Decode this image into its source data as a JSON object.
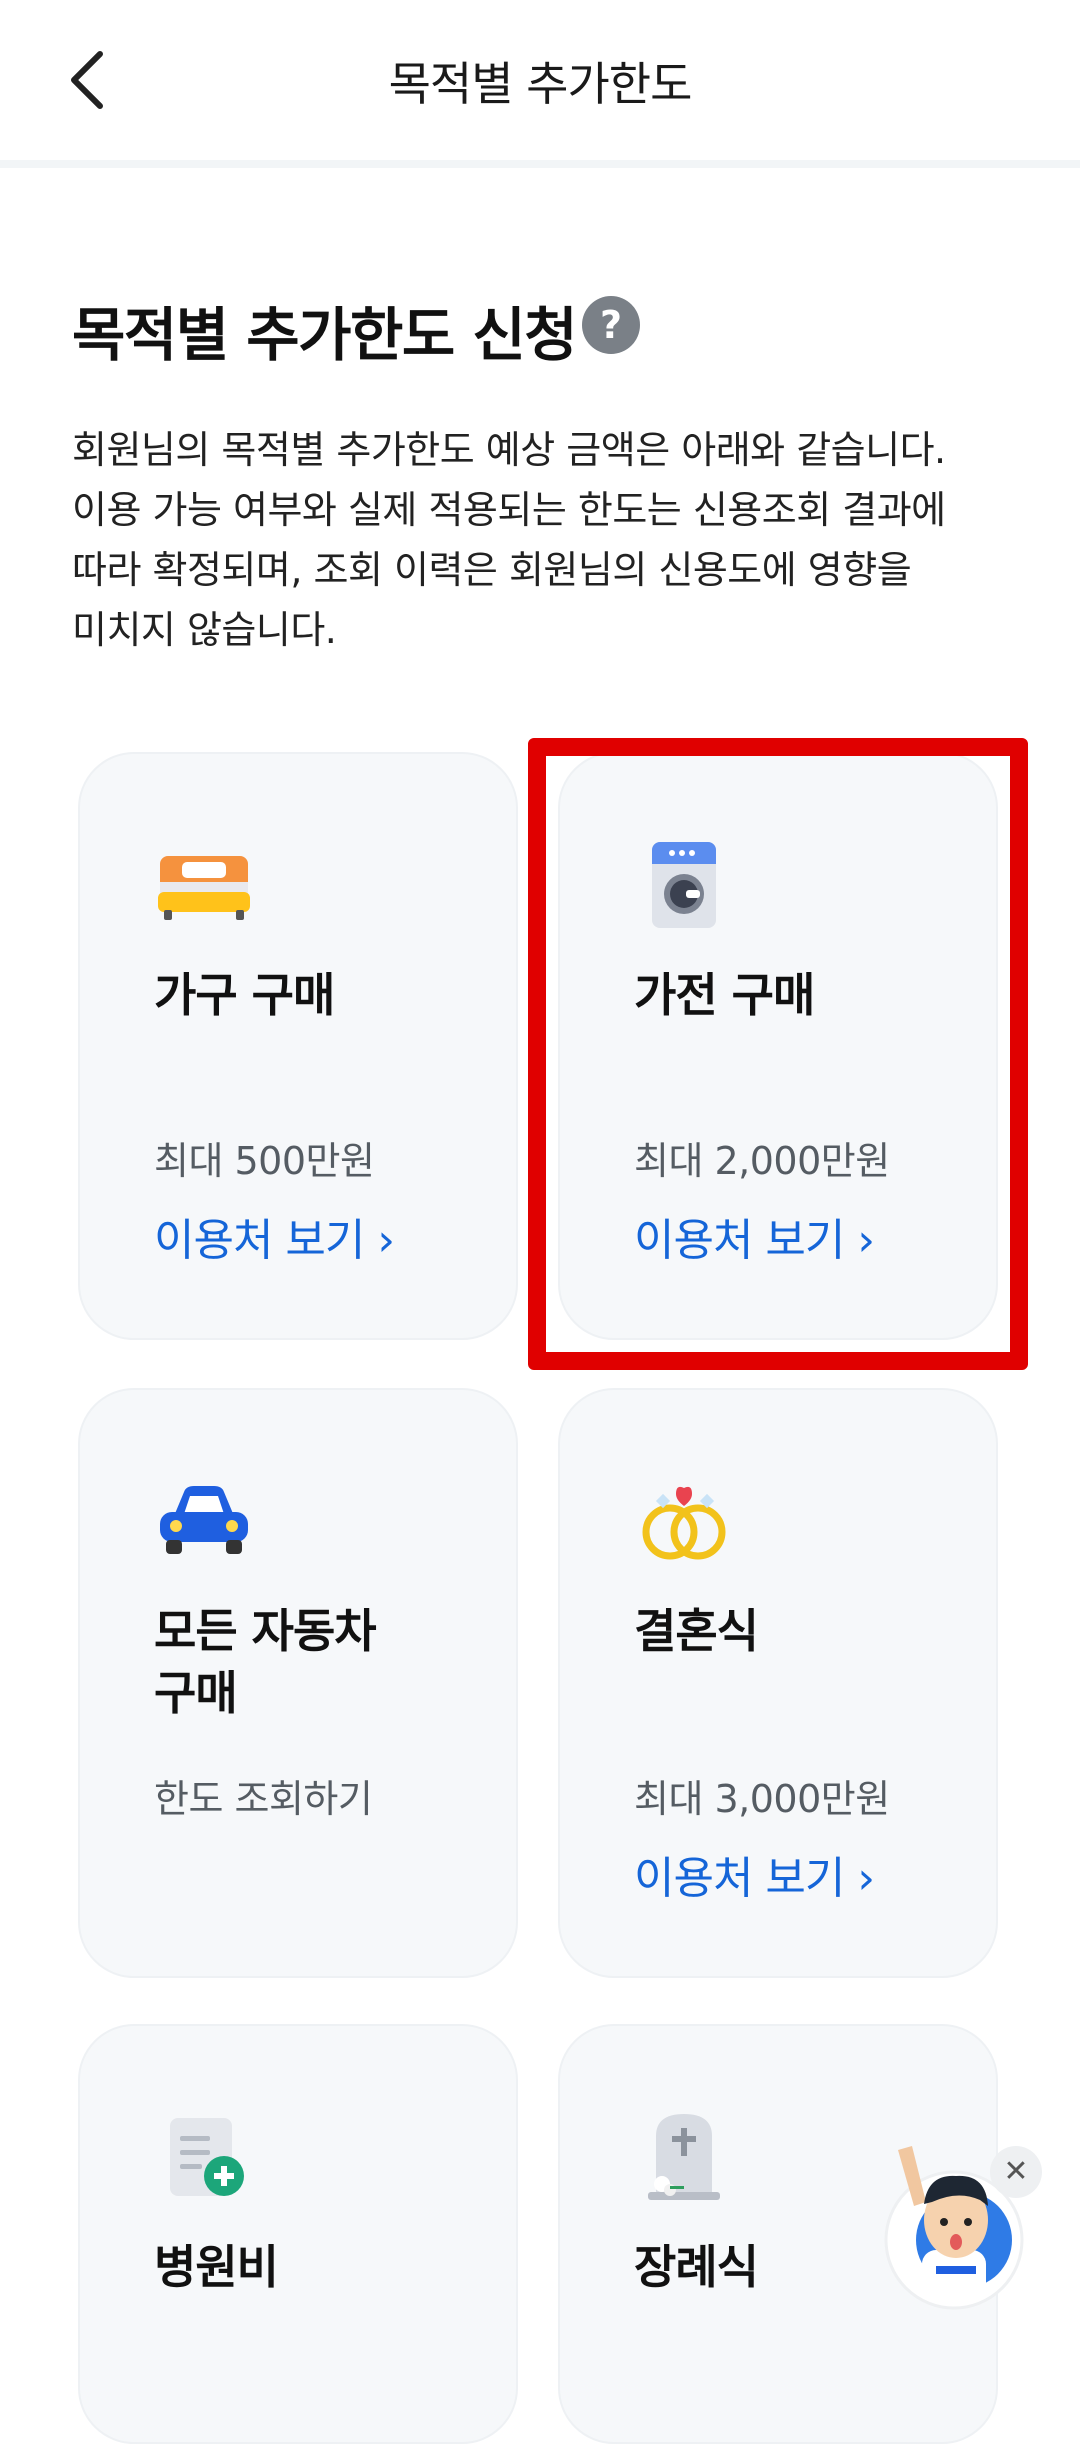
{
  "header": {
    "title": "목적별 추가한도"
  },
  "main": {
    "title": "목적별 추가한도 신청",
    "help": "?",
    "description": [
      "회원님의 목적별 추가한도 예상 금액은 아래와 같습니다.",
      "이용 가능 여부와 실제 적용되는 한도는 신용조회 결과에",
      "따라 확정되며, 조회 이력은 회원님의 신용도에 영향을",
      "미치지 않습니다."
    ]
  },
  "cards": [
    {
      "icon": "bed-icon",
      "title": "가구 구매",
      "limit": "최대 500만원",
      "link": "이용처 보기 ›"
    },
    {
      "icon": "washing-machine-icon",
      "title": "가전 구매",
      "limit": "최대 2,000만원",
      "link": "이용처 보기 ›"
    },
    {
      "icon": "car-icon",
      "title_line1": "모든 자동차",
      "title_line2": "구매",
      "limit": "한도 조회하기"
    },
    {
      "icon": "wedding-rings-icon",
      "title": "결혼식",
      "limit": "최대 3,000만원",
      "link": "이용처 보기 ›"
    },
    {
      "icon": "medical-document-icon",
      "title": "병원비"
    },
    {
      "icon": "tombstone-icon",
      "title": "장례식"
    }
  ],
  "floating": {
    "close": "✕"
  },
  "colors": {
    "accent": "#1565d8",
    "highlight": "#e00000",
    "card_bg": "#f6f8fa"
  }
}
